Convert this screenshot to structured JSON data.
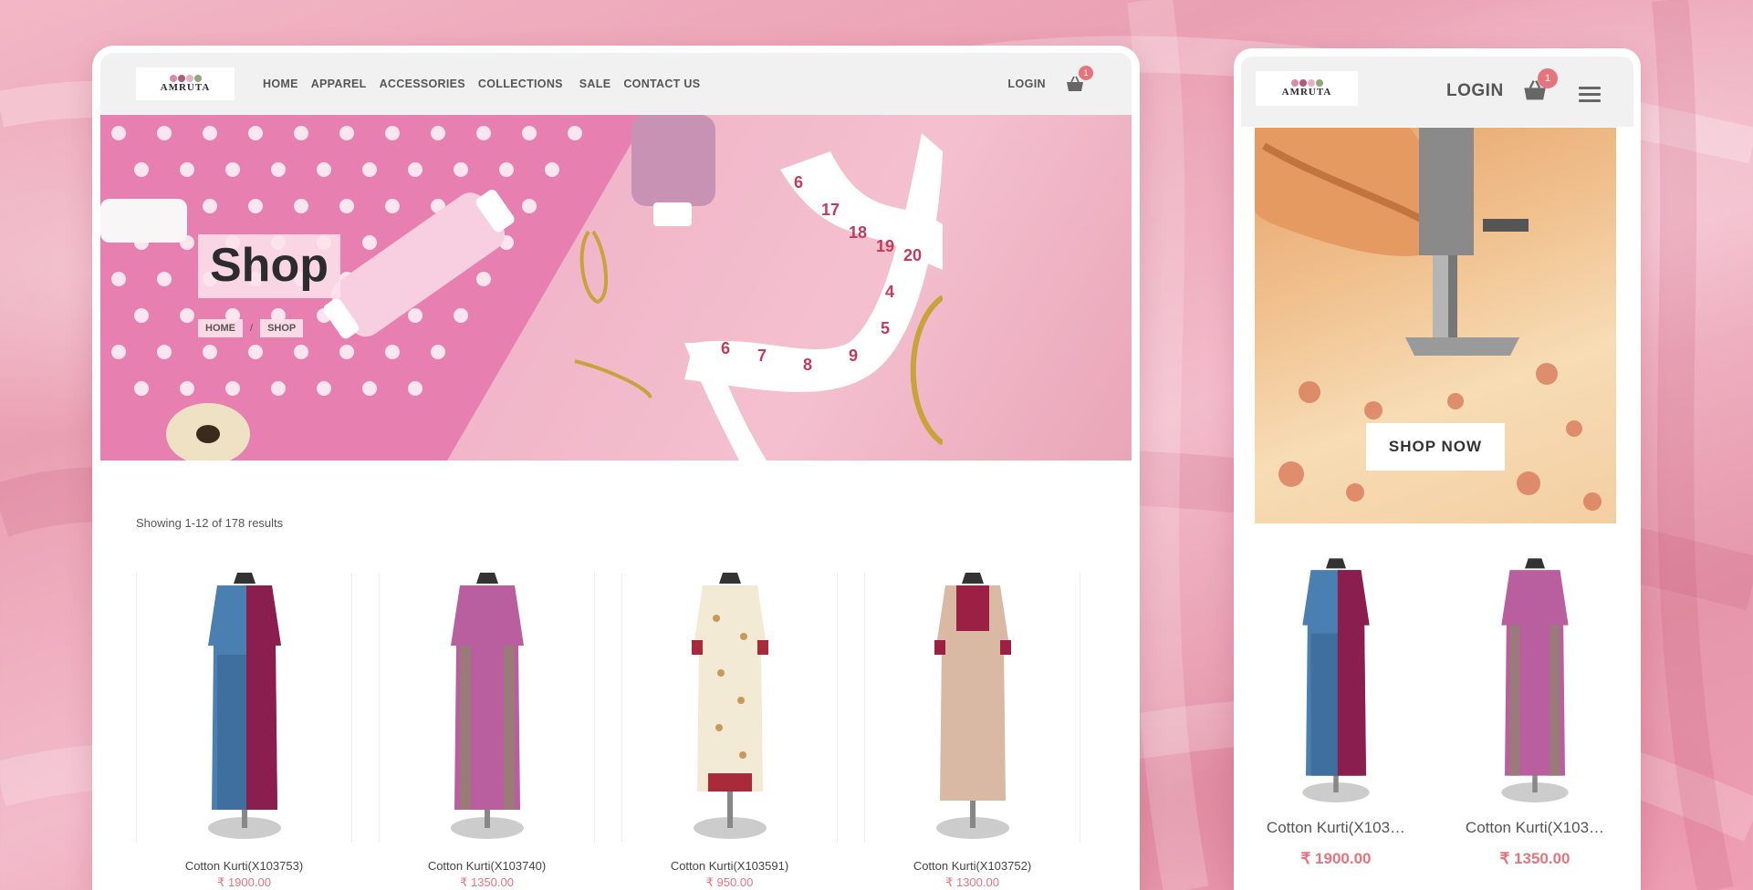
{
  "desktop": {
    "logo_text": "AMRUTA",
    "nav": [
      "HOME",
      "APPAREL",
      "ACCESSORIES",
      "COLLECTIONS",
      "SALE",
      "CONTACT US"
    ],
    "login_label": "LOGIN",
    "cart_count": "1",
    "hero": {
      "title": "Shop",
      "breadcrumb": [
        "HOME",
        "/",
        "SHOP"
      ]
    },
    "results_text": "Showing 1-12 of 178 results",
    "products": [
      {
        "name": "Cotton Kurti(X103753)",
        "price": "₹ 1900.00"
      },
      {
        "name": "Cotton Kurti(X103740)",
        "price": "₹ 1350.00"
      },
      {
        "name": "Cotton Kurti(X103591)",
        "price": "₹ 950.00"
      },
      {
        "name": "Cotton Kurti(X103752)",
        "price": "₹ 1300.00"
      }
    ]
  },
  "mobile": {
    "logo_text": "AMRUTA",
    "login_label": "LOGIN",
    "cart_count": "1",
    "shop_now_label": "SHOP NOW",
    "products": [
      {
        "name": "Cotton Kurti(X103…",
        "price": "₹ 1900.00"
      },
      {
        "name": "Cotton Kurti(X103…",
        "price": "₹ 1350.00"
      }
    ]
  },
  "colors": {
    "accent_price": "#e6747d",
    "header_bg": "#f1f1f1",
    "background_pink": "#eaa0b3"
  },
  "icons": {
    "cart": "basket-icon",
    "menu": "hamburger-menu-icon"
  }
}
